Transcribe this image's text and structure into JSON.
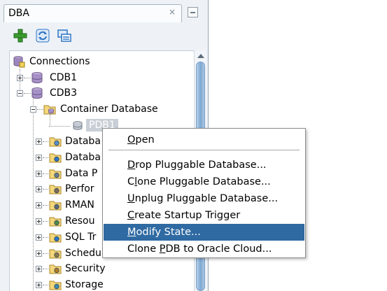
{
  "panel": {
    "title": "DBA",
    "close_glyph": "×"
  },
  "toolbar": {
    "buttons": [
      {
        "name": "add-connection-icon",
        "color": "#3a9a2f"
      },
      {
        "name": "refresh-icon",
        "color": "#2d74c4"
      },
      {
        "name": "filter-icon",
        "color": "#2d74c4"
      }
    ]
  },
  "tree": {
    "root_label": "Connections",
    "cdb1_label": "CDB1",
    "cdb3_label": "CDB3",
    "container_label": "Container Database",
    "pdb_label": "PDB1",
    "children": [
      {
        "label": "Databa",
        "icon": "database-config-folder-icon"
      },
      {
        "label": "Databa",
        "icon": "database-status-folder-icon"
      },
      {
        "label": "Data P",
        "icon": "data-pump-folder-icon"
      },
      {
        "label": "Perfor",
        "icon": "performance-folder-icon"
      },
      {
        "label": "RMAN",
        "icon": "rman-folder-icon"
      },
      {
        "label": "Resou",
        "icon": "resource-manager-folder-icon"
      },
      {
        "label": "SQL Tr",
        "icon": "sql-translator-folder-icon"
      },
      {
        "label": "Schedu",
        "icon": "scheduler-folder-icon"
      },
      {
        "label": "Security",
        "icon": "security-folder-icon"
      },
      {
        "label": "Storage",
        "icon": "storage-folder-icon"
      }
    ]
  },
  "context_menu": {
    "items": [
      {
        "pre": "",
        "ul": "O",
        "post": "pen"
      },
      {
        "pre": "",
        "ul": "D",
        "post": "rop Pluggable Database..."
      },
      {
        "pre": "C",
        "ul": "l",
        "post": "one Pluggable Database..."
      },
      {
        "pre": "",
        "ul": "U",
        "post": "nplug Pluggable Database..."
      },
      {
        "pre": "",
        "ul": "C",
        "post": "reate Startup Trigger"
      },
      {
        "pre": "",
        "ul": "M",
        "post": "odify State..."
      },
      {
        "pre": "Clone ",
        "ul": "P",
        "post": "DB to Oracle Cloud..."
      }
    ],
    "highlighted_index": 5,
    "highlight_color": "#2f6aa2"
  }
}
